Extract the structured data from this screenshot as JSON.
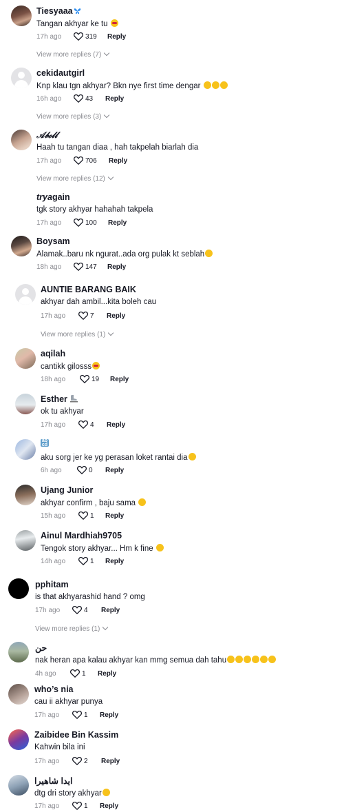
{
  "comments": [
    {
      "username": "Tiesyaaa",
      "text": "Tangan akhyar ke tu",
      "time": "17h ago",
      "likes": "319",
      "reply": "Reply",
      "view_more": "View more replies (7)",
      "username_decoration": "blue-butterfly-emoji",
      "text_emoji": "flushed-face-emoji"
    },
    {
      "username": "cekidautgirl",
      "text": "Knp klau tgn akhyar? Bkn nye first time dengar",
      "time": "16h ago",
      "likes": "43",
      "reply": "Reply",
      "view_more": "View more replies (3)",
      "text_emoji": "laughing-tears-emoji x3"
    },
    {
      "username": "𝒜𝒷ℯ𝓁𝓁",
      "text": "Haah tu tangan diaa , hah takpelah biarlah dia",
      "time": "17h ago",
      "likes": "706",
      "reply": "Reply",
      "view_more": "View more replies (12)"
    },
    {
      "username_prefix": "trya",
      "username_suffix": "gain",
      "text": "tgk story akhyar hahahah takpela",
      "time": "17h ago",
      "likes": "100",
      "reply": "Reply"
    },
    {
      "username": "Boysam",
      "text": "Alamak..baru nk ngurat..ada org pulak kt seblah",
      "time": "18h ago",
      "likes": "147",
      "reply": "Reply",
      "text_emoji": "laughing-tears-emoji"
    },
    {
      "username": "AUNTIE BARANG BAIK",
      "text": "akhyar dah ambil...kita boleh cau",
      "time": "17h ago",
      "likes": "7",
      "reply": "Reply",
      "view_more": "View more replies (1)"
    },
    {
      "username": "aqilah",
      "text": "cantikk gilosss",
      "time": "18h ago",
      "likes": "19",
      "reply": "Reply",
      "text_emoji": "heart-eyes-emoji"
    },
    {
      "username": "Esther",
      "text": "ok tu akhyar",
      "time": "17h ago",
      "likes": "4",
      "reply": "Reply",
      "username_decoration": "ice-skate-emoji"
    },
    {
      "username": "abcd-emoji",
      "text": "aku sorg jer ke yg perasan loket rantai dia",
      "time": "6h ago",
      "likes": "0",
      "reply": "Reply",
      "text_emoji": "relieved-face-emoji"
    },
    {
      "username": "Ujang Junior",
      "text": "akhyar confirm , baju sama",
      "time": "15h ago",
      "likes": "1",
      "reply": "Reply",
      "text_emoji": "rofl-emoji"
    },
    {
      "username": "Ainul Mardhiah9705",
      "text": "Tengok story akhyar... Hm k fine",
      "time": "14h ago",
      "likes": "1",
      "reply": "Reply",
      "text_emoji": "pleading-face-emoji"
    },
    {
      "username": "pphitam",
      "text": "is that akhyarashid hand ? omg",
      "time": "17h ago",
      "likes": "4",
      "reply": "Reply",
      "view_more": "View more replies (1)"
    },
    {
      "username": "حن",
      "text": "nak heran apa kalau akhyar kan mmg semua dah tahu",
      "time": "4h ago",
      "likes": "1",
      "reply": "Reply",
      "text_emoji": "crying-emoji x3, rofl-emoji x3"
    },
    {
      "username": "who’s nia",
      "text": "cau ii akhyar punya",
      "time": "17h ago",
      "likes": "1",
      "reply": "Reply"
    },
    {
      "username": "Zaibidee Bin Kassim",
      "text": "Kahwin bila ini",
      "time": "17h ago",
      "likes": "2",
      "reply": "Reply"
    },
    {
      "username": "ايدا شاهيرا",
      "text": "dtg dri story akhyar",
      "time": "17h ago",
      "likes": "1",
      "reply": "Reply",
      "text_emoji": "pleading-face-emoji"
    }
  ],
  "colors": {
    "text": "#161823",
    "muted": "#8a8b91",
    "background": "#ffffff"
  }
}
